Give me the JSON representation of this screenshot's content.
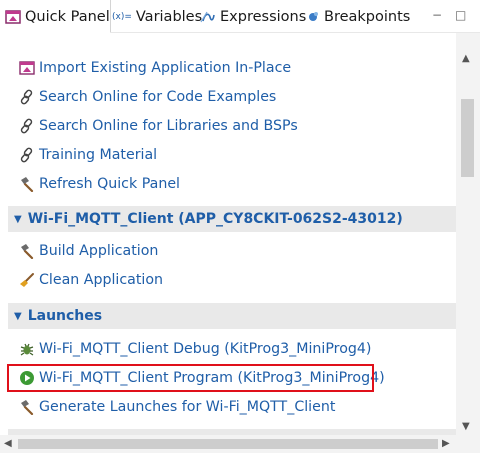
{
  "tabs": [
    {
      "label": "Quick Panel",
      "icon": "quick-panel-icon",
      "active": true
    },
    {
      "label": "Variables",
      "icon": "variables-icon",
      "icon_text": "(x)=",
      "active": false
    },
    {
      "label": "Expressions",
      "icon": "expressions-icon",
      "active": false
    },
    {
      "label": "Breakpoints",
      "icon": "breakpoints-icon",
      "active": false
    }
  ],
  "window_controls": {
    "minimize": "−",
    "maximize": "□"
  },
  "general": {
    "items": [
      {
        "label": "Import Existing Application In-Place",
        "icon": "import-icon"
      },
      {
        "label": "Search Online for Code Examples",
        "icon": "link-icon"
      },
      {
        "label": "Search Online for Libraries and BSPs",
        "icon": "link-icon"
      },
      {
        "label": "Training Material",
        "icon": "link-icon"
      },
      {
        "label": "Refresh Quick Panel",
        "icon": "hammer-icon"
      }
    ]
  },
  "app_section": {
    "title": "Wi-Fi_MQTT_Client (APP_CY8CKIT-062S2-43012)",
    "items": [
      {
        "label": "Build Application",
        "icon": "hammer-icon"
      },
      {
        "label": "Clean Application",
        "icon": "broom-icon"
      }
    ]
  },
  "launches_section": {
    "title": "Launches",
    "items": [
      {
        "label": "Wi-Fi_MQTT_Client Debug (KitProg3_MiniProg4)",
        "icon": "debug-bug-icon"
      },
      {
        "label": "Wi-Fi_MQTT_Client Program (KitProg3_MiniProg4)",
        "icon": "run-play-icon",
        "highlighted": true
      },
      {
        "label": "Generate Launches for Wi-Fi_MQTT_Client",
        "icon": "hammer-icon"
      }
    ]
  },
  "colors": {
    "link": "#1f5ea8",
    "section_bg": "#e9e9e9",
    "highlight_border": "#e0101a"
  }
}
